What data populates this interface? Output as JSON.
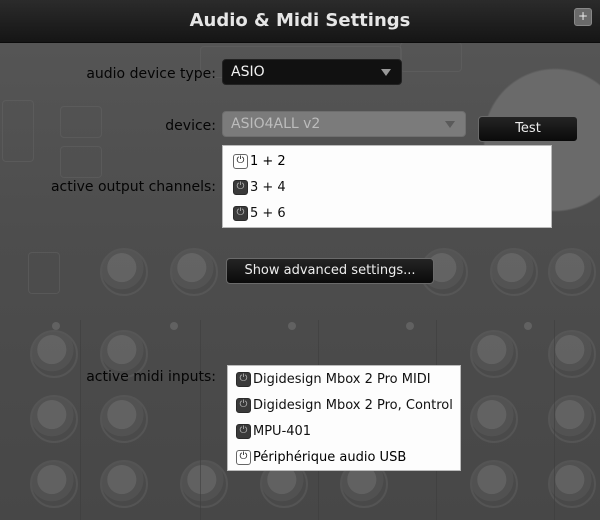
{
  "window": {
    "title": "Audio & Midi Settings",
    "corner_button": "+"
  },
  "audio_device_type": {
    "label": "audio device type:",
    "value": "ASIO"
  },
  "device": {
    "label": "device:",
    "value": "ASIO4ALL v2",
    "test_label": "Test"
  },
  "output_channels": {
    "label": "active output channels:",
    "items": [
      {
        "label": "1 + 2",
        "enabled": true
      },
      {
        "label": "3 + 4",
        "enabled": false
      },
      {
        "label": "5 + 6",
        "enabled": false
      }
    ]
  },
  "advanced": {
    "label": "Show advanced settings..."
  },
  "midi_inputs": {
    "label": "active midi inputs:",
    "items": [
      {
        "label": "Digidesign Mbox 2 Pro MIDI",
        "enabled": false
      },
      {
        "label": "Digidesign Mbox 2 Pro, Control",
        "enabled": false
      },
      {
        "label": "MPU-401",
        "enabled": false
      },
      {
        "label": "Périphérique audio USB",
        "enabled": true
      }
    ]
  },
  "icons": {
    "power": "power-icon",
    "dropdown": "chevron-down-icon"
  },
  "colors": {
    "titlebar": "#1c1c1c",
    "background": "#4f4f4f",
    "listbox": "#fdfdfd"
  }
}
